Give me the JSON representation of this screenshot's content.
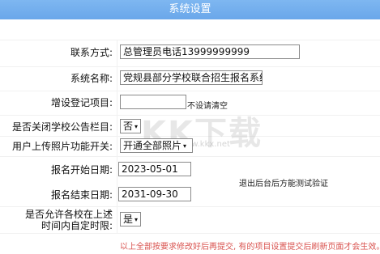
{
  "header": {
    "title": "系统设置"
  },
  "contact": {
    "label": "联系方式:",
    "value": "总管理员电话13999999999"
  },
  "system_name": {
    "label": "系统名称:",
    "value": "党规县部分学校联合招生报名系统"
  },
  "extra_item": {
    "label": "增设登记项目:",
    "value": "",
    "hint": "不设请清空"
  },
  "close_bulletin": {
    "label": "是否关闭学校公告栏目:",
    "selected": "否"
  },
  "photo_upload": {
    "label": "用户上传照片功能开关:",
    "selected": "开通全部照片"
  },
  "start_date": {
    "label": "报名开始日期:",
    "value": "2023-05-01"
  },
  "end_date": {
    "label": "报名结束日期:",
    "value": "2031-09-30"
  },
  "date_note": "退出后台后方能测试验证",
  "custom_limit": {
    "label_line1": "是否允许各校在上述",
    "label_line2": "时间内自定时限:",
    "selected": "是"
  },
  "footer_note": "以上全部按要求修改好后再提交, 有的项目设置提交后刷新页面才会生效。",
  "watermark": {
    "main": "KK下载",
    "sub": "www.kkx.net"
  }
}
